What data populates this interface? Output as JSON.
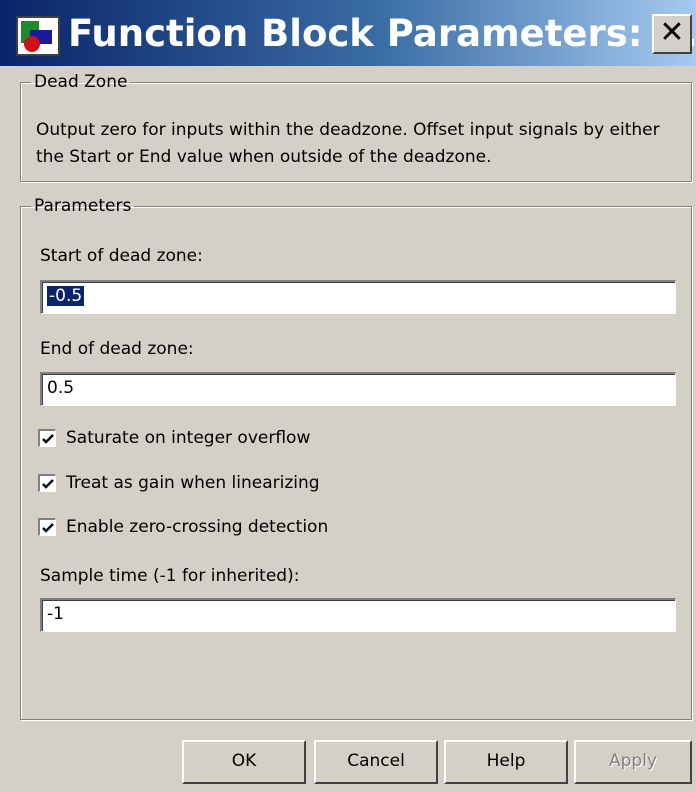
{
  "window": {
    "title": "Function Block Parameters: ...",
    "close_glyph": "✕",
    "icon": "simulink-block-icon"
  },
  "description_group": {
    "legend": "Dead Zone",
    "text": "Output zero for inputs within the deadzone.  Offset input signals by either the Start or End value when outside of the deadzone."
  },
  "parameters_group": {
    "legend": "Parameters",
    "start_label": "Start of dead zone:",
    "start_value": "-0.5",
    "end_label": "End of dead zone:",
    "end_value": "0.5",
    "checkboxes": [
      {
        "label": "Saturate on integer overflow",
        "checked": true
      },
      {
        "label": "Treat as gain when linearizing",
        "checked": true
      },
      {
        "label": "Enable zero-crossing detection",
        "checked": true
      }
    ],
    "sample_time_label": "Sample time (-1 for inherited):",
    "sample_time_value": "-1"
  },
  "buttons": {
    "ok": "OK",
    "cancel": "Cancel",
    "help": "Help",
    "apply": "Apply"
  },
  "colors": {
    "titlebar_start": "#0a246a",
    "titlebar_end": "#a6caf0",
    "selection": "#0a246a",
    "dialog_bg": "#d4d0c8"
  }
}
